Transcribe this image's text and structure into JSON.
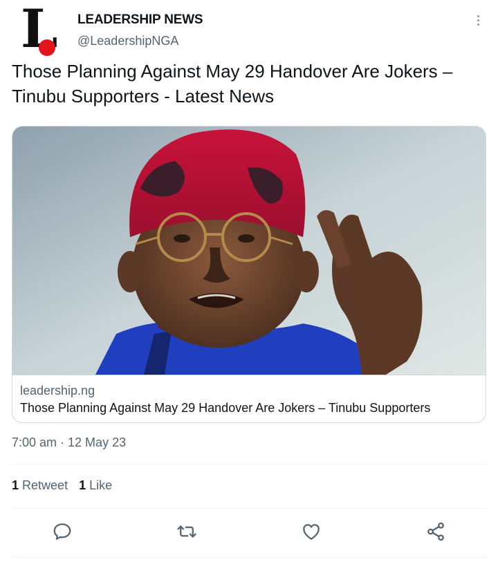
{
  "account": {
    "display_name": "LEADERSHIP NEWS",
    "handle": "@LeadershipNGA",
    "logo_letter": "L"
  },
  "tweet": {
    "text": "Those Planning Against May 29 Handover Are Jokers – Tinubu Supporters - Latest News",
    "timestamp": "7:00 am · 12 May 23"
  },
  "card": {
    "domain": "leadership.ng",
    "title": "Those Planning Against May 29 Handover Are Jokers  – Tinubu Supporters"
  },
  "stats": {
    "retweets_count": "1",
    "retweets_label": "Retweet",
    "likes_count": "1",
    "likes_label": "Like"
  },
  "icons": {
    "more": "more-vertical-icon",
    "reply": "reply-icon",
    "retweet": "retweet-icon",
    "like": "heart-icon",
    "share": "share-icon"
  },
  "colors": {
    "text_primary": "#0f1419",
    "text_secondary": "#536471",
    "border": "#cfd9de",
    "brand_red": "#e3151a"
  }
}
